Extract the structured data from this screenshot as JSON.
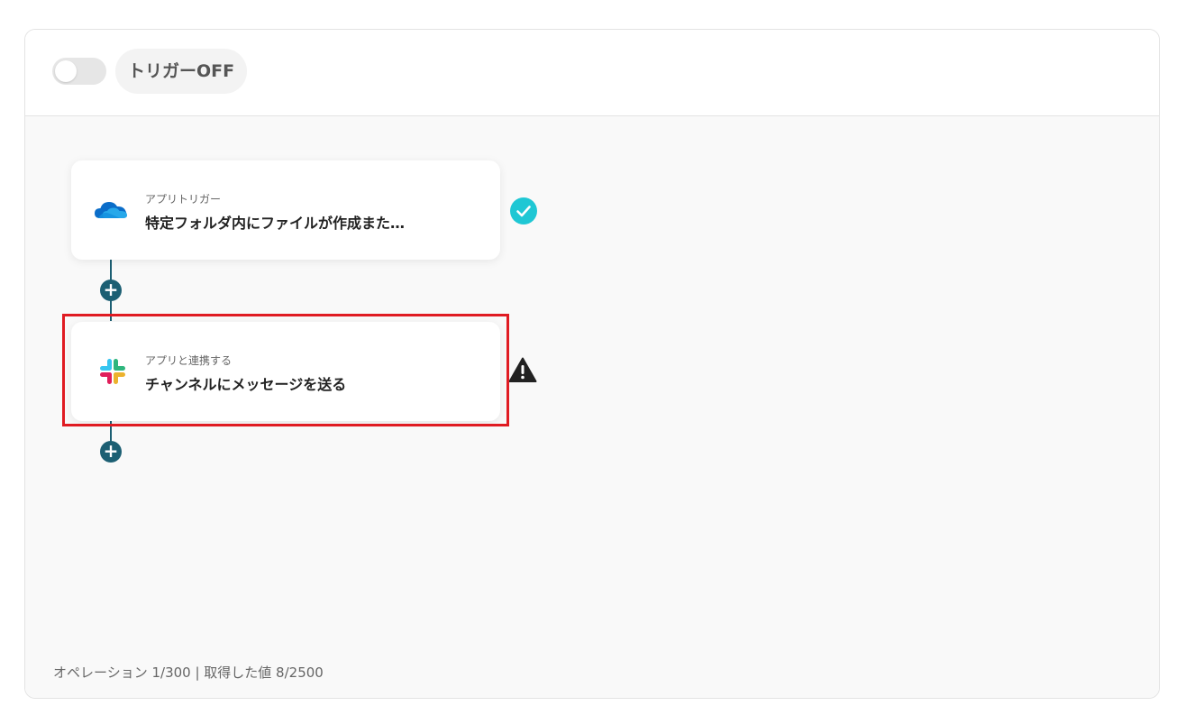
{
  "header": {
    "trigger_toggle_state": "off",
    "trigger_label": "トリガーOFF"
  },
  "flow": {
    "steps": [
      {
        "subtitle": "アプリトリガー",
        "title": "特定フォルダ内にファイルが作成また…",
        "app_icon": "onedrive-icon",
        "status_icon": "check-circle-icon",
        "status_color": "#1fc7d4"
      },
      {
        "subtitle": "アプリと連携する",
        "title": "チャンネルにメッセージを送る",
        "app_icon": "slack-icon",
        "status_icon": "warning-icon",
        "status_color": "#222222",
        "highlighted": true,
        "highlight_color": "#e01b22"
      }
    ],
    "add_button_symbol": "+",
    "connector_color": "#1c5f73"
  },
  "footer": {
    "usage_text": "オペレーション 1/300 | 取得した値 8/2500"
  }
}
